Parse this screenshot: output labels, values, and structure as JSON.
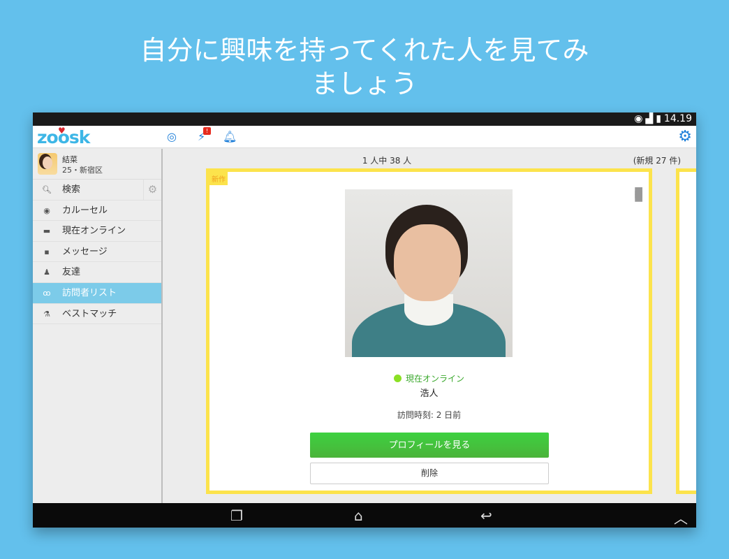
{
  "headline": {
    "line1": "自分に興味を持ってくれた人を見てみ",
    "line2": "ましょう"
  },
  "status_bar": {
    "time": "14.19"
  },
  "app": {
    "logo": "zoosk"
  },
  "profile": {
    "name": "結菜",
    "details": "25・新宿区"
  },
  "sidebar": {
    "items": [
      {
        "label": "検索",
        "icon": "search-icon"
      },
      {
        "label": "カルーセル",
        "icon": "carousel-icon"
      },
      {
        "label": "現在オンライン",
        "icon": "online-icon"
      },
      {
        "label": "メッセージ",
        "icon": "message-icon"
      },
      {
        "label": "友達",
        "icon": "friends-icon"
      },
      {
        "label": "訪問者リスト",
        "icon": "glasses-icon",
        "active": true
      },
      {
        "label": "ベストマッチ",
        "icon": "flask-icon"
      }
    ]
  },
  "main": {
    "count": "1 人中 38 人",
    "new_count": "(新規 27 件)"
  },
  "card": {
    "new_tag": "新作",
    "online_status": "現在オンライン",
    "name": "浩人",
    "visit_time": "訪問時刻: 2 日前",
    "view_profile": "プロフィールを見る",
    "delete": "削除"
  },
  "notification_badge": "!"
}
